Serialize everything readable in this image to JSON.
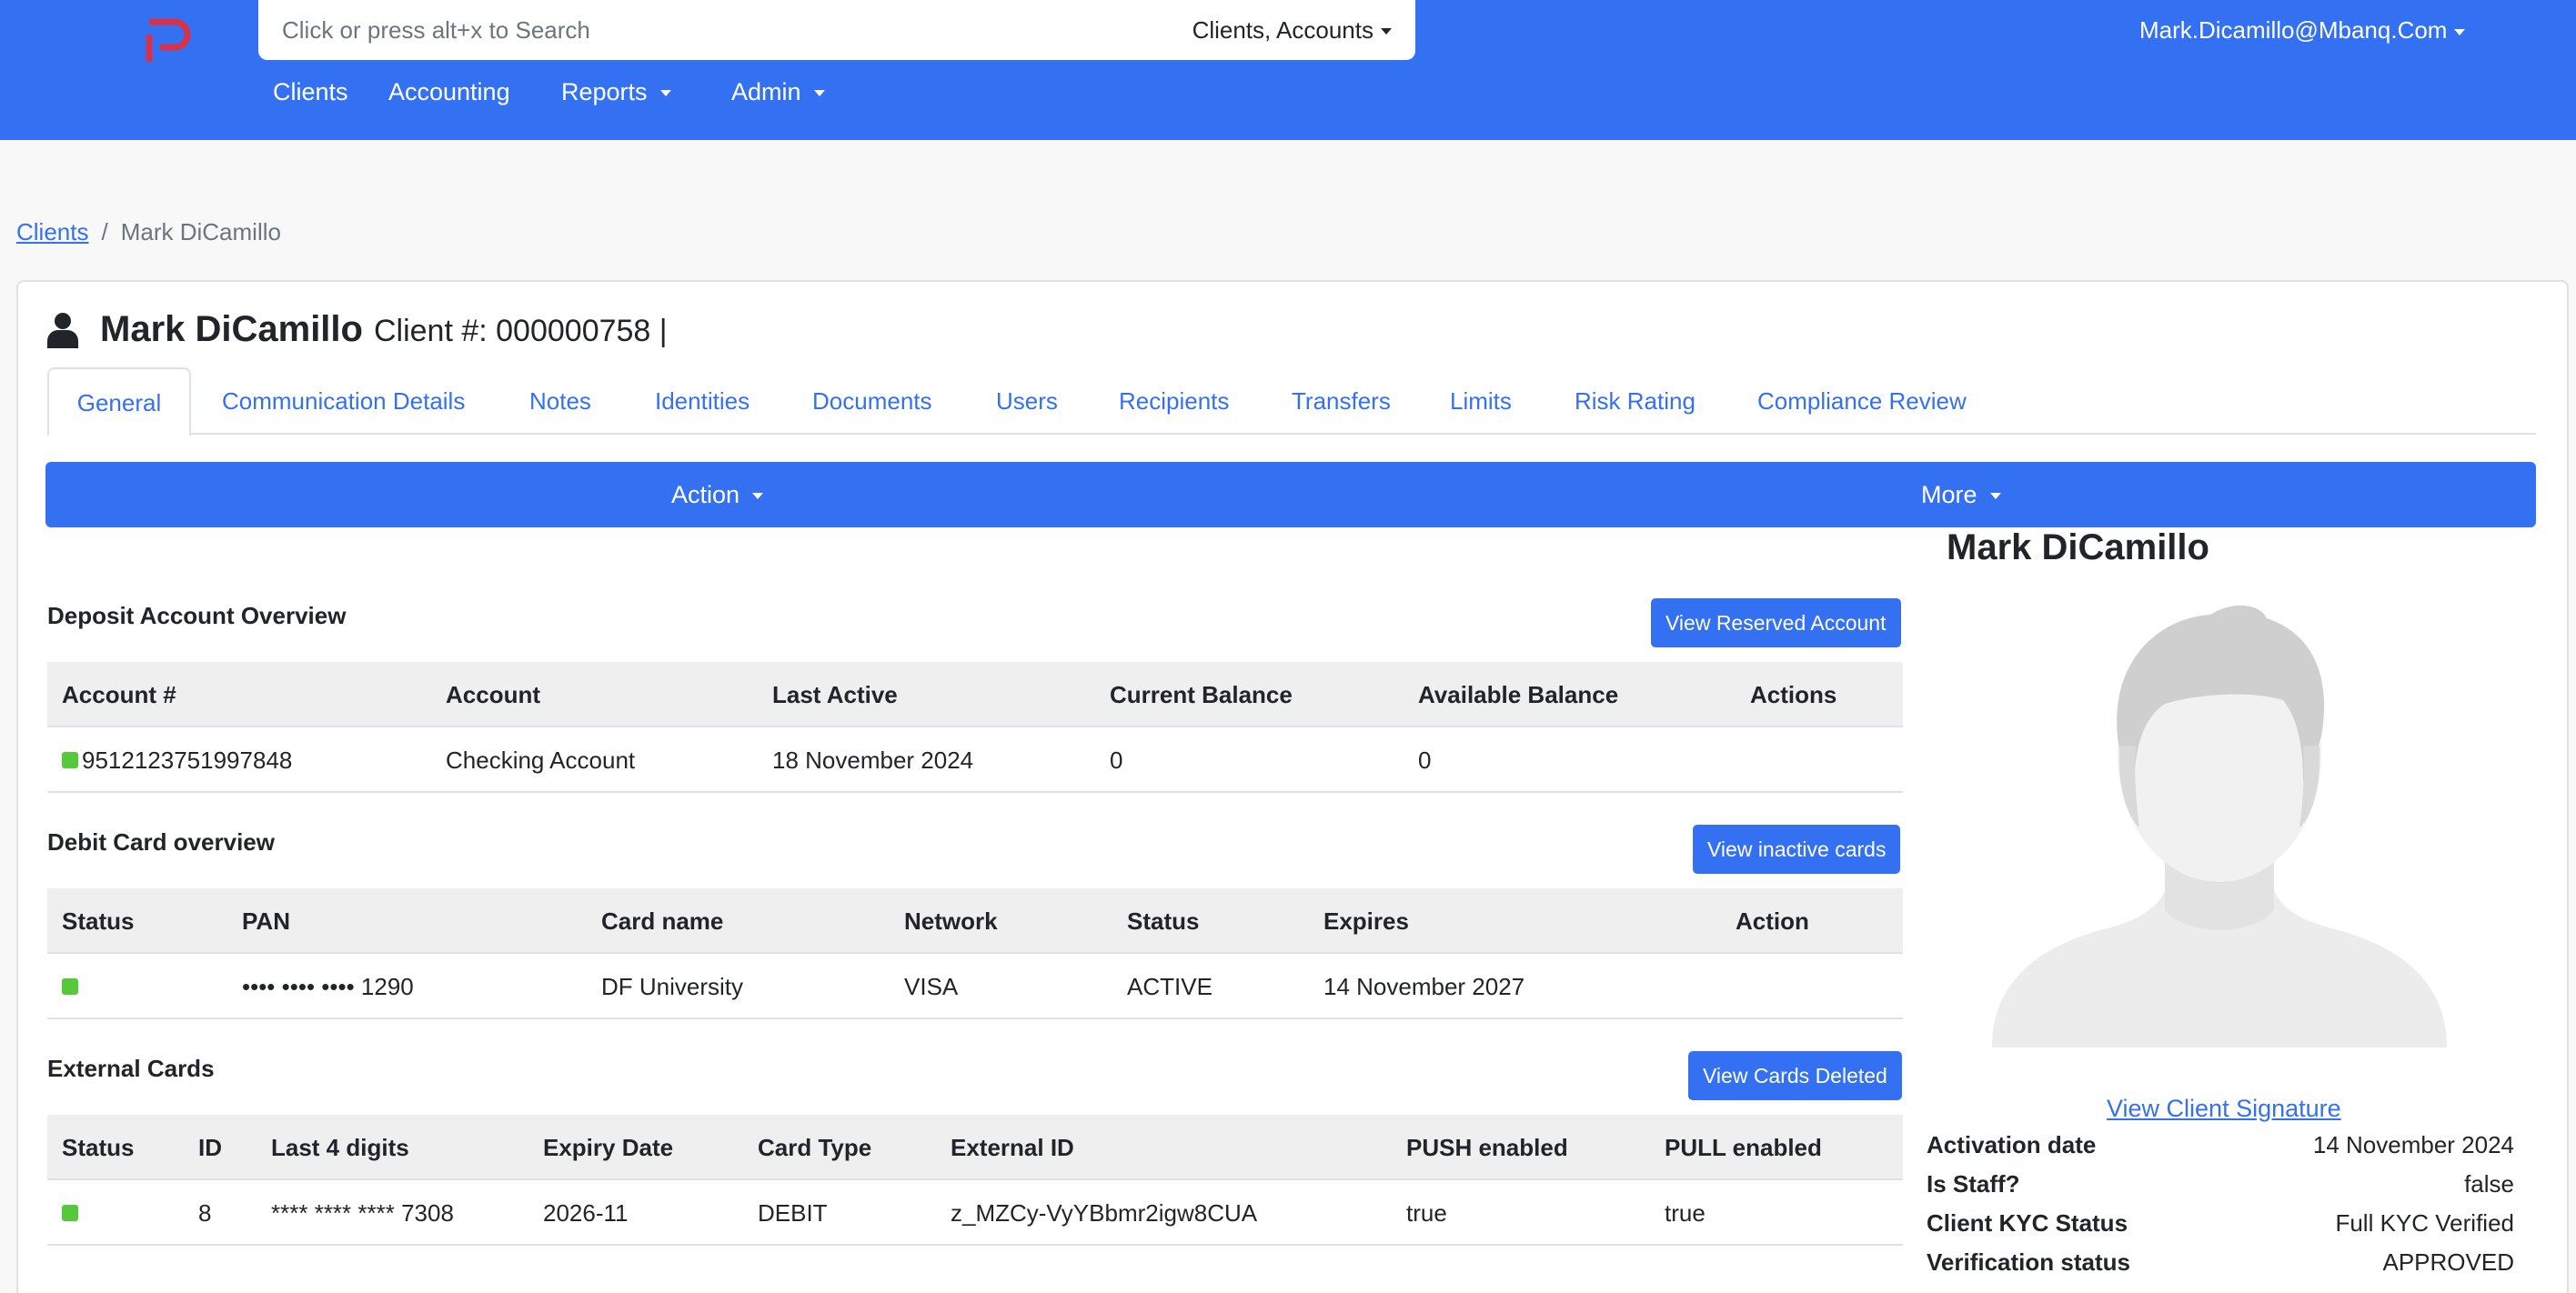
{
  "topbar": {
    "search_placeholder": "Click or press alt+x to Search",
    "search_scope": "Clients, Accounts",
    "user_email": "Mark.Dicamillo@Mbanq.Com",
    "nav": [
      {
        "label": "Clients",
        "dropdown": false
      },
      {
        "label": "Accounting",
        "dropdown": false
      },
      {
        "label": "Reports",
        "dropdown": true
      },
      {
        "label": "Admin",
        "dropdown": true
      }
    ]
  },
  "breadcrumb": {
    "root": "Clients",
    "separator": "/",
    "current": "Mark DiCamillo"
  },
  "client": {
    "name": "Mark DiCamillo",
    "client_number": "Client #: 000000758 |"
  },
  "tabs": [
    "General",
    "Communication Details",
    "Notes",
    "Identities",
    "Documents",
    "Users",
    "Recipients",
    "Transfers",
    "Limits",
    "Risk Rating",
    "Compliance Review"
  ],
  "actionbar": {
    "action_label": "Action",
    "more_label": "More"
  },
  "deposit": {
    "title": "Deposit Account Overview",
    "button": "View Reserved Account",
    "headers": [
      "Account #",
      "Account",
      "Last Active",
      "Current Balance",
      "Available Balance",
      "Actions"
    ],
    "rows": [
      {
        "account_no": "9512123751997848",
        "account": "Checking Account",
        "last_active": "18 November 2024",
        "current_balance": "0",
        "available_balance": "0",
        "actions": "",
        "status_color": "#55c93a"
      }
    ]
  },
  "debit": {
    "title": "Debit Card overview",
    "button": "View inactive cards",
    "headers": [
      "Status",
      "PAN",
      "Card name",
      "Network",
      "Status",
      "Expires",
      "Action"
    ],
    "rows": [
      {
        "pan": "•••• •••• •••• 1290",
        "card_name": "DF University",
        "network": "VISA",
        "status": "ACTIVE",
        "expires": "14 November 2027",
        "action": "",
        "status_color": "#55c93a"
      }
    ]
  },
  "external": {
    "title": "External Cards",
    "button": "View Cards Deleted",
    "headers": [
      "Status",
      "ID",
      "Last 4 digits",
      "Expiry Date",
      "Card Type",
      "External ID",
      "PUSH enabled",
      "PULL enabled"
    ],
    "rows": [
      {
        "id": "8",
        "last4": "**** **** **** 7308",
        "expiry": "2026-11",
        "type": "DEBIT",
        "external_id": "z_MZCy-VyYBbmr2igw8CUA",
        "push": "true",
        "pull": "true",
        "status_color": "#55c93a"
      }
    ]
  },
  "profile": {
    "name": "Mark DiCamillo",
    "signature_link": "View Client Signature",
    "info": [
      {
        "label": "Activation date",
        "value": "14 November 2024"
      },
      {
        "label": "Is Staff?",
        "value": "false"
      },
      {
        "label": "Client KYC Status",
        "value": "Full KYC Verified"
      },
      {
        "label": "Verification status",
        "value": "APPROVED"
      }
    ]
  },
  "colors": {
    "brand": "#3371f2",
    "status_active": "#55c93a",
    "logo": "#d6334a"
  },
  "icons": [
    "logo-icon",
    "person-icon",
    "avatar-placeholder-icon",
    "chevron-down-icon"
  ]
}
